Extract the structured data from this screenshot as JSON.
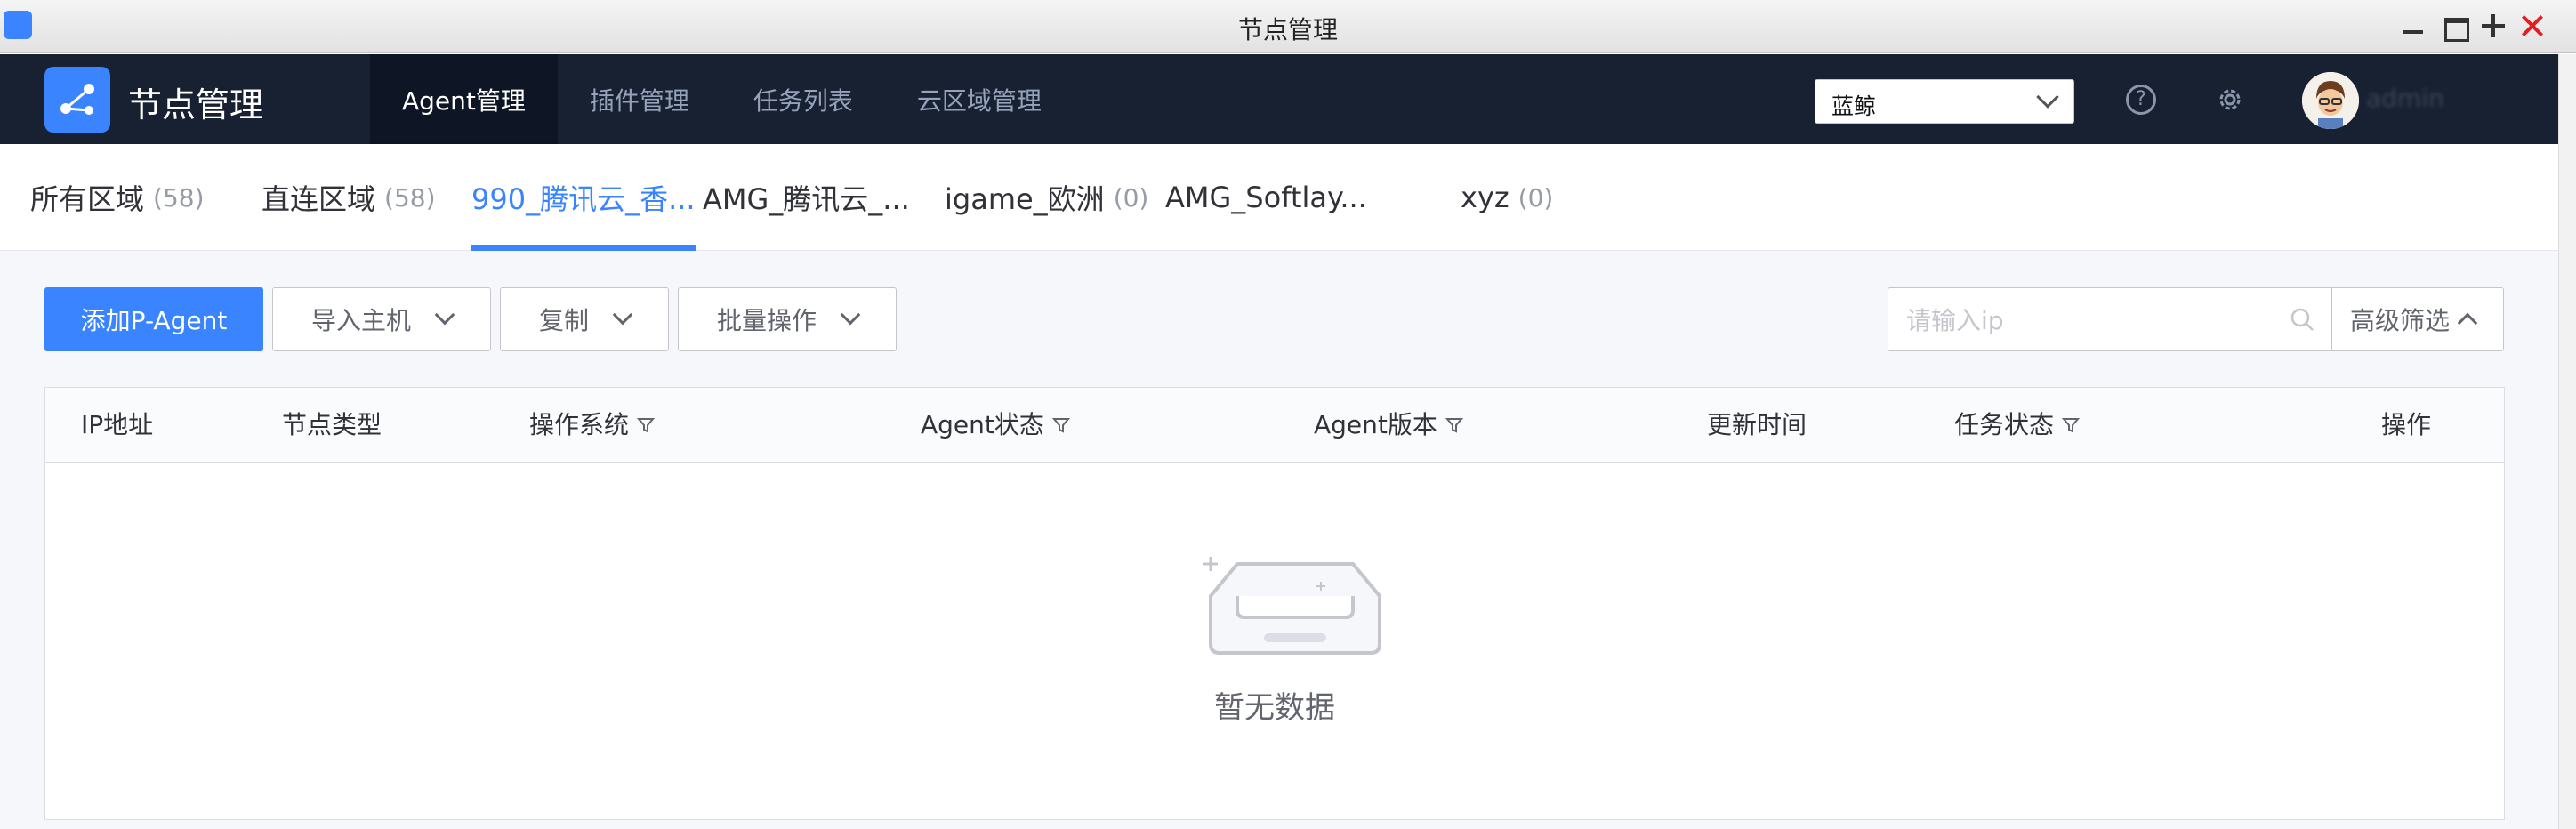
{
  "window": {
    "title": "节点管理"
  },
  "header": {
    "app_name": "节点管理",
    "nav": [
      {
        "label": "Agent管理",
        "active": true
      },
      {
        "label": "插件管理",
        "active": false
      },
      {
        "label": "任务列表",
        "active": false
      },
      {
        "label": "云区域管理",
        "active": false
      }
    ],
    "business_select": {
      "value": "蓝鲸"
    },
    "user": {
      "name": "admin"
    }
  },
  "tabs": [
    {
      "label": "所有区域",
      "count": "(58)",
      "active": false
    },
    {
      "label": "直连区域",
      "count": "(58)",
      "active": false
    },
    {
      "label": "990_腾讯云_香...",
      "count": "",
      "active": true
    },
    {
      "label": "AMG_腾讯云_...",
      "count": "",
      "active": false
    },
    {
      "label": "igame_欧洲",
      "count": "(0)",
      "active": false
    },
    {
      "label": "AMG_Softlay...",
      "count": "",
      "active": false
    },
    {
      "label": "xyz",
      "count": "(0)",
      "active": false
    }
  ],
  "toolbar": {
    "add_label": "添加P-Agent",
    "import_label": "导入主机",
    "copy_label": "复制",
    "batch_label": "批量操作",
    "search_placeholder": "请输入ip",
    "adv_filter_label": "高级筛选"
  },
  "table": {
    "columns": [
      "IP地址",
      "节点类型",
      "操作系统",
      "Agent状态",
      "Agent版本",
      "更新时间",
      "任务状态",
      "操作"
    ],
    "rows": [],
    "empty_text": "暂无数据"
  },
  "colors": {
    "primary": "#3a84ff",
    "header_bg": "#182132",
    "nav_active_bg": "#0e1525"
  }
}
